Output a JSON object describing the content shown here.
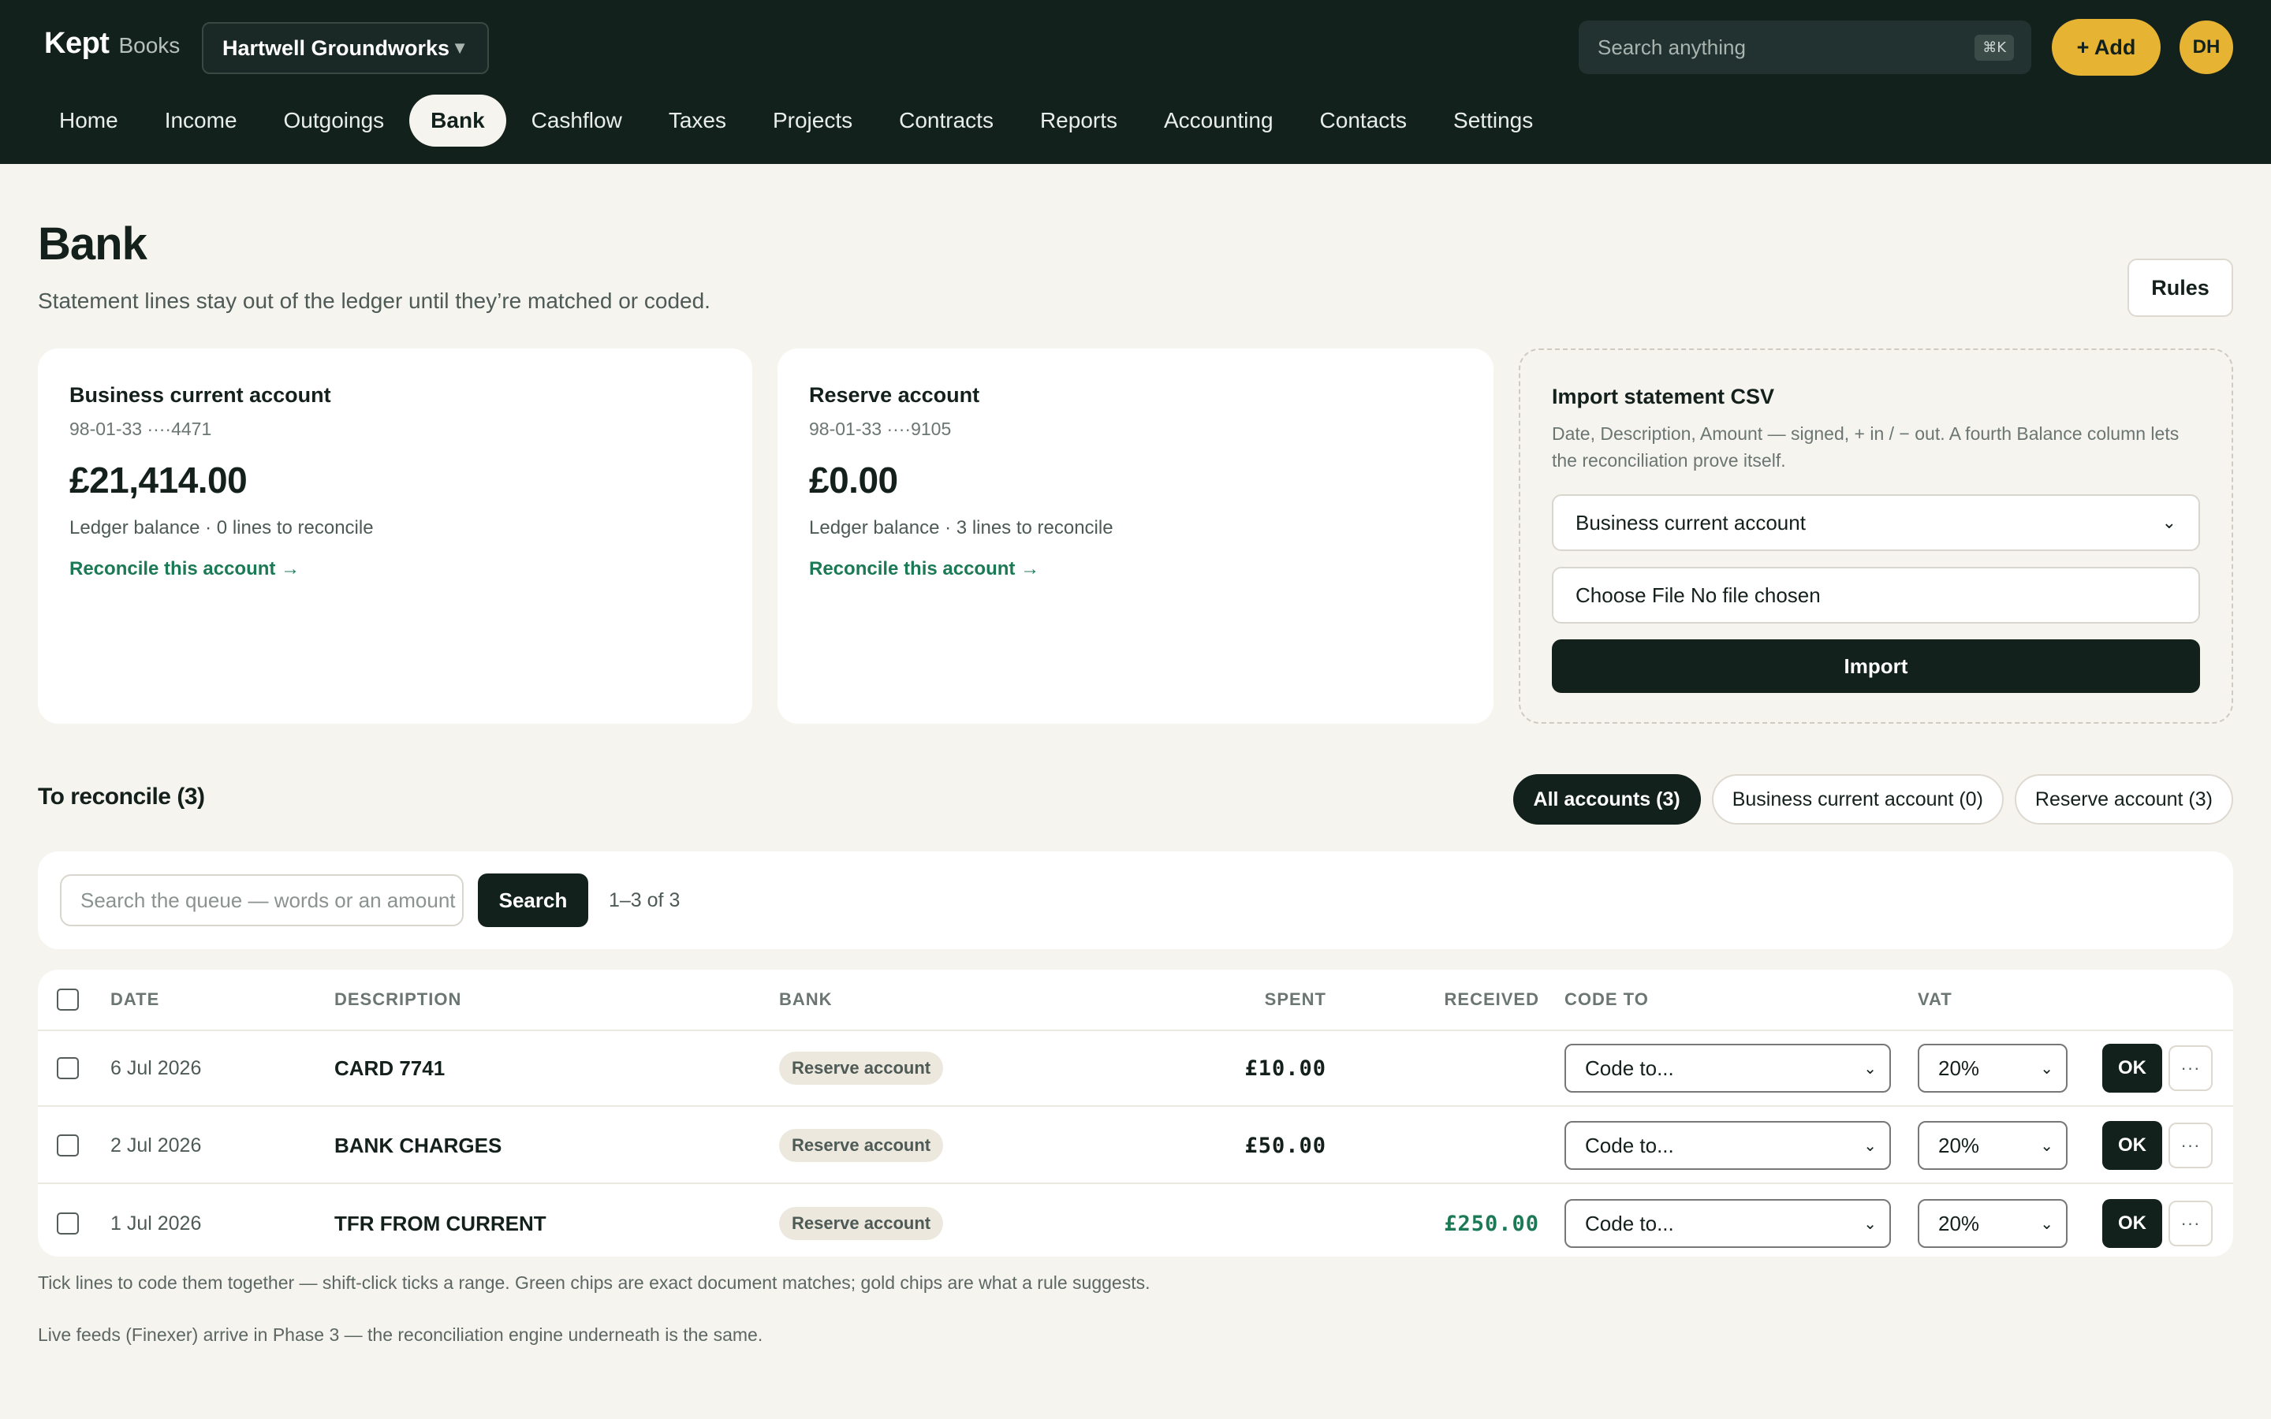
{
  "header": {
    "brand": "Kept",
    "brand_sub": "Books",
    "org": "Hartwell Groundworks",
    "search_placeholder": "Search anything",
    "search_shortcut": "⌘K",
    "add_label": "+ Add",
    "avatar_initials": "DH"
  },
  "nav": [
    "Home",
    "Income",
    "Outgoings",
    "Bank",
    "Cashflow",
    "Taxes",
    "Projects",
    "Contracts",
    "Reports",
    "Accounting",
    "Contacts",
    "Settings"
  ],
  "nav_active": "Bank",
  "page": {
    "title": "Bank",
    "subtitle": "Statement lines stay out of the ledger until they’re matched or coded.",
    "rules_label": "Rules"
  },
  "accounts": [
    {
      "name": "Business current account",
      "number": "98-01-33 ····4471",
      "balance": "£21,414.00",
      "meta": "Ledger balance · 0 lines to reconcile",
      "link": "Reconcile this account →"
    },
    {
      "name": "Reserve account",
      "number": "98-01-33 ····9105",
      "balance": "£0.00",
      "meta": "Ledger balance · 3 lines to reconcile",
      "link": "Reconcile this account →"
    }
  ],
  "import": {
    "title": "Import statement CSV",
    "description": "Date, Description, Amount — signed, + in / − out. A fourth Balance column lets the reconciliation prove itself.",
    "account_select": "Business current account",
    "file_label": "Choose File No file chosen",
    "button": "Import"
  },
  "reconcile": {
    "title": "To reconcile (3)",
    "filters": [
      "All accounts (3)",
      "Business current account (0)",
      "Reserve account (3)"
    ],
    "search_placeholder": "Search the queue — words or an amount",
    "search_button": "Search",
    "count": "1–3 of 3",
    "columns": {
      "date": "DATE",
      "description": "DESCRIPTION",
      "bank": "BANK",
      "spent": "SPENT",
      "received": "RECEIVED",
      "code_to": "CODE TO",
      "vat": "VAT"
    },
    "rows": [
      {
        "date": "6 Jul 2026",
        "description": "CARD 7741",
        "bank": "Reserve account",
        "spent": "£10.00",
        "received": "",
        "code": "Code to...",
        "vat": "20%",
        "ok": "OK",
        "more": "···"
      },
      {
        "date": "2 Jul 2026",
        "description": "BANK CHARGES",
        "bank": "Reserve account",
        "spent": "£50.00",
        "received": "",
        "code": "Code to...",
        "vat": "20%",
        "ok": "OK",
        "more": "···"
      },
      {
        "date": "1 Jul 2026",
        "description": "TFR FROM CURRENT",
        "bank": "Reserve account",
        "spent": "",
        "received": "£250.00",
        "code": "Code to...",
        "vat": "20%",
        "ok": "OK",
        "more": "···"
      }
    ]
  },
  "notes": [
    "Tick lines to code them together — shift-click ticks a range. Green chips are exact document matches; gold chips are what a rule suggests.",
    "Live feeds (Finexer) arrive in Phase 3 — the reconciliation engine underneath is the same."
  ],
  "colors": {
    "header_bg": "#13211d",
    "accent": "#e6b333",
    "link_green": "#1b7a55",
    "page_bg": "#f6f4ef"
  }
}
